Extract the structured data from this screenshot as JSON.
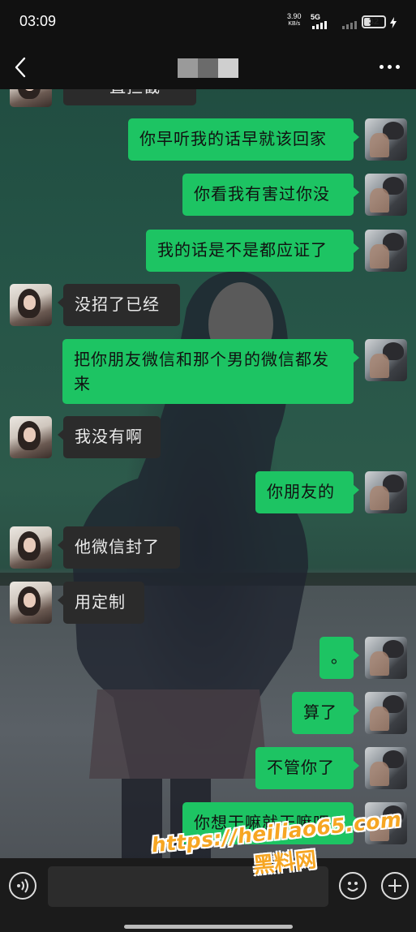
{
  "status_bar": {
    "time": "03:09",
    "net_speed_value": "3.90",
    "net_speed_unit": "KB/s",
    "network": "5G",
    "battery_level": "32",
    "battery_fraction": 0.32
  },
  "header": {
    "title": ""
  },
  "messages": [
    {
      "side": "them",
      "text": "···一直拦截"
    },
    {
      "side": "me",
      "text": "你早听我的话早就该回家"
    },
    {
      "side": "me",
      "text": "你看我有害过你没"
    },
    {
      "side": "me",
      "text": "我的话是不是都应证了"
    },
    {
      "side": "them",
      "text": "没招了已经"
    },
    {
      "side": "me",
      "text": "把你朋友微信和那个男的微信都发来"
    },
    {
      "side": "them",
      "text": "我没有啊"
    },
    {
      "side": "me",
      "text": "你朋友的"
    },
    {
      "side": "them",
      "text": "他微信封了"
    },
    {
      "side": "them",
      "text": "用定制"
    },
    {
      "side": "me",
      "text": "。"
    },
    {
      "side": "me",
      "text": "算了"
    },
    {
      "side": "me",
      "text": "不管你了"
    },
    {
      "side": "me",
      "text": "你想干嘛就干嘛吧"
    }
  ],
  "watermark": {
    "url": "https://heiliao65.com",
    "name": "黑料网"
  },
  "icons": {
    "back": "back-chevron-icon",
    "more": "more-dots-icon",
    "voice": "voice-input-icon",
    "emoji": "emoji-icon",
    "plus": "plus-icon"
  }
}
